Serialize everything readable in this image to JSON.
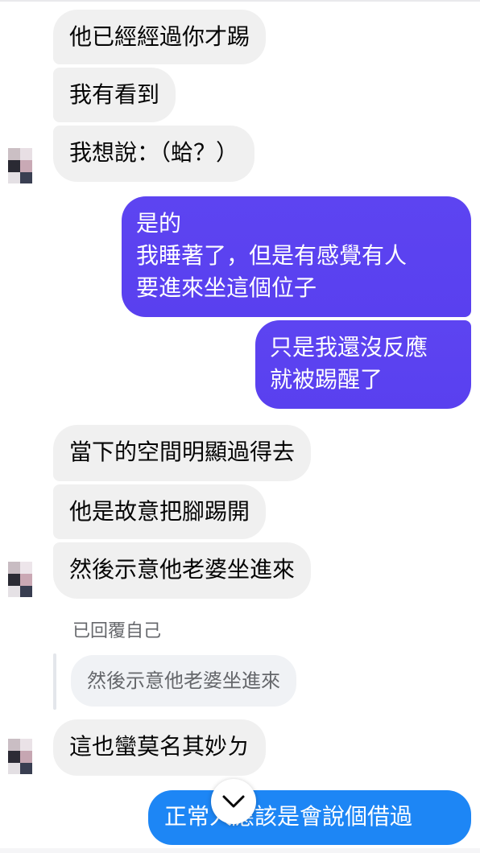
{
  "messages": {
    "m1": "他已經經過你才踢",
    "m2": "我有看到",
    "m3": "我想說：（蛤？）",
    "m4_line1": "是的",
    "m4_line2": "我睡著了，但是有感覺有人",
    "m4_line3": "要進來坐這個位子",
    "m5_line1": "只是我還沒反應",
    "m5_line2": "就被踢醒了",
    "m6": "當下的空間明顯過得去",
    "m7": "他是故意把腳踢開",
    "m8": "然後示意他老婆坐進來",
    "reply_label": "已回覆自己",
    "quoted": "然後示意他老婆坐進來",
    "m9": "這也蠻莫名其妙ㄉ",
    "m10": "正常人應該是會說個借過"
  },
  "icons": {
    "scroll_down": "chevron-down-icon",
    "avatar": "blurred-avatar"
  },
  "colors": {
    "incoming_bubble": "#f0f0f0",
    "outgoing_bubble": "#5b3ff0",
    "outgoing_blue": "#1d86f5",
    "reply_label": "#65676b"
  }
}
